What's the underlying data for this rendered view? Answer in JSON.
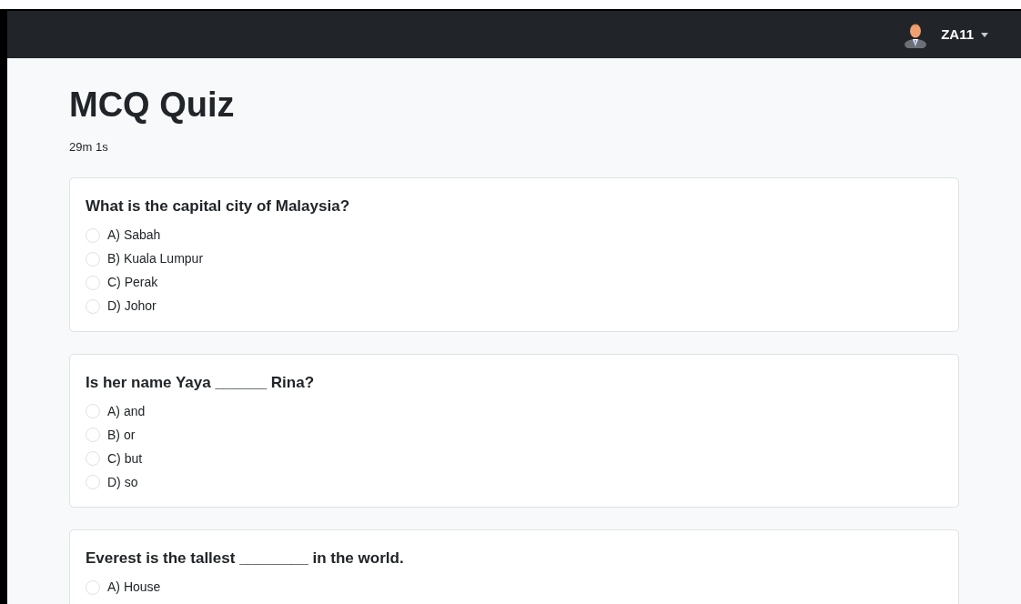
{
  "navbar": {
    "user": "ZA11"
  },
  "title": "MCQ Quiz",
  "timer": "29m 1s",
  "questions": [
    {
      "text": "What is the capital city of Malaysia?",
      "options": [
        {
          "label": "A) Sabah",
          "selected": false
        },
        {
          "label": "B) Kuala Lumpur",
          "selected": false
        },
        {
          "label": "C) Perak",
          "selected": false
        },
        {
          "label": "D) Johor",
          "selected": false
        }
      ]
    },
    {
      "text": "Is her name Yaya ______ Rina?",
      "options": [
        {
          "label": "A) and",
          "selected": false
        },
        {
          "label": "B) or",
          "selected": false
        },
        {
          "label": "C) but",
          "selected": false
        },
        {
          "label": "D) so",
          "selected": false
        }
      ]
    },
    {
      "text": "Everest is the tallest ________ in the world.",
      "options": [
        {
          "label": "A) House",
          "selected": false
        }
      ]
    }
  ]
}
